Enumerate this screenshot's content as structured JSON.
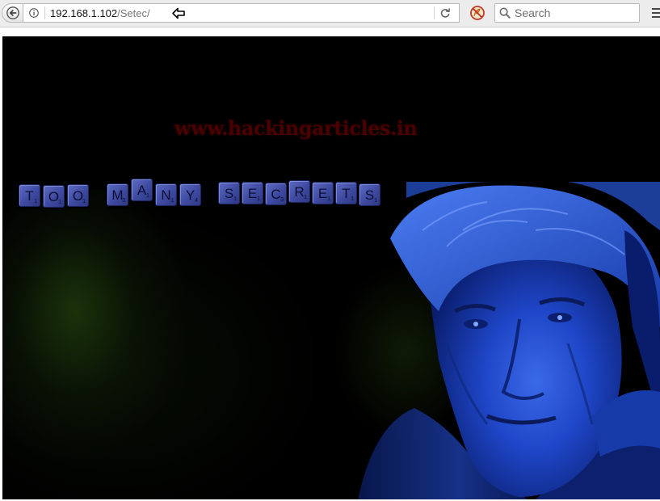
{
  "browser": {
    "url_host": "192.168.1.102",
    "url_path": "/Setec/",
    "search_placeholder": "Search",
    "icons": {
      "back": "back-arrow-icon",
      "info": "info-icon",
      "cursor": "cursor-arrow-icon",
      "reload": "reload-icon",
      "noscript": "noscript-icon",
      "search": "search-icon",
      "menu": "hamburger-menu-icon"
    }
  },
  "page": {
    "watermark": "www.hackingarticles.in",
    "tiles": [
      {
        "letter": "T",
        "score": "1"
      },
      {
        "letter": "O",
        "score": "1"
      },
      {
        "letter": "O",
        "score": "1"
      },
      {
        "letter": "M",
        "score": "3"
      },
      {
        "letter": "A",
        "score": "1"
      },
      {
        "letter": "N",
        "score": "1"
      },
      {
        "letter": "Y",
        "score": "4"
      },
      {
        "letter": "S",
        "score": "1"
      },
      {
        "letter": "E",
        "score": "1"
      },
      {
        "letter": "C",
        "score": "3"
      },
      {
        "letter": "R",
        "score": "1"
      },
      {
        "letter": "E",
        "score": "1"
      },
      {
        "letter": "T",
        "score": "1"
      },
      {
        "letter": "S",
        "score": "1"
      }
    ],
    "colors": {
      "background": "#000000",
      "tile": "#4a57ae",
      "watermark": "#4a0000",
      "portrait": "#1f46c8"
    }
  }
}
